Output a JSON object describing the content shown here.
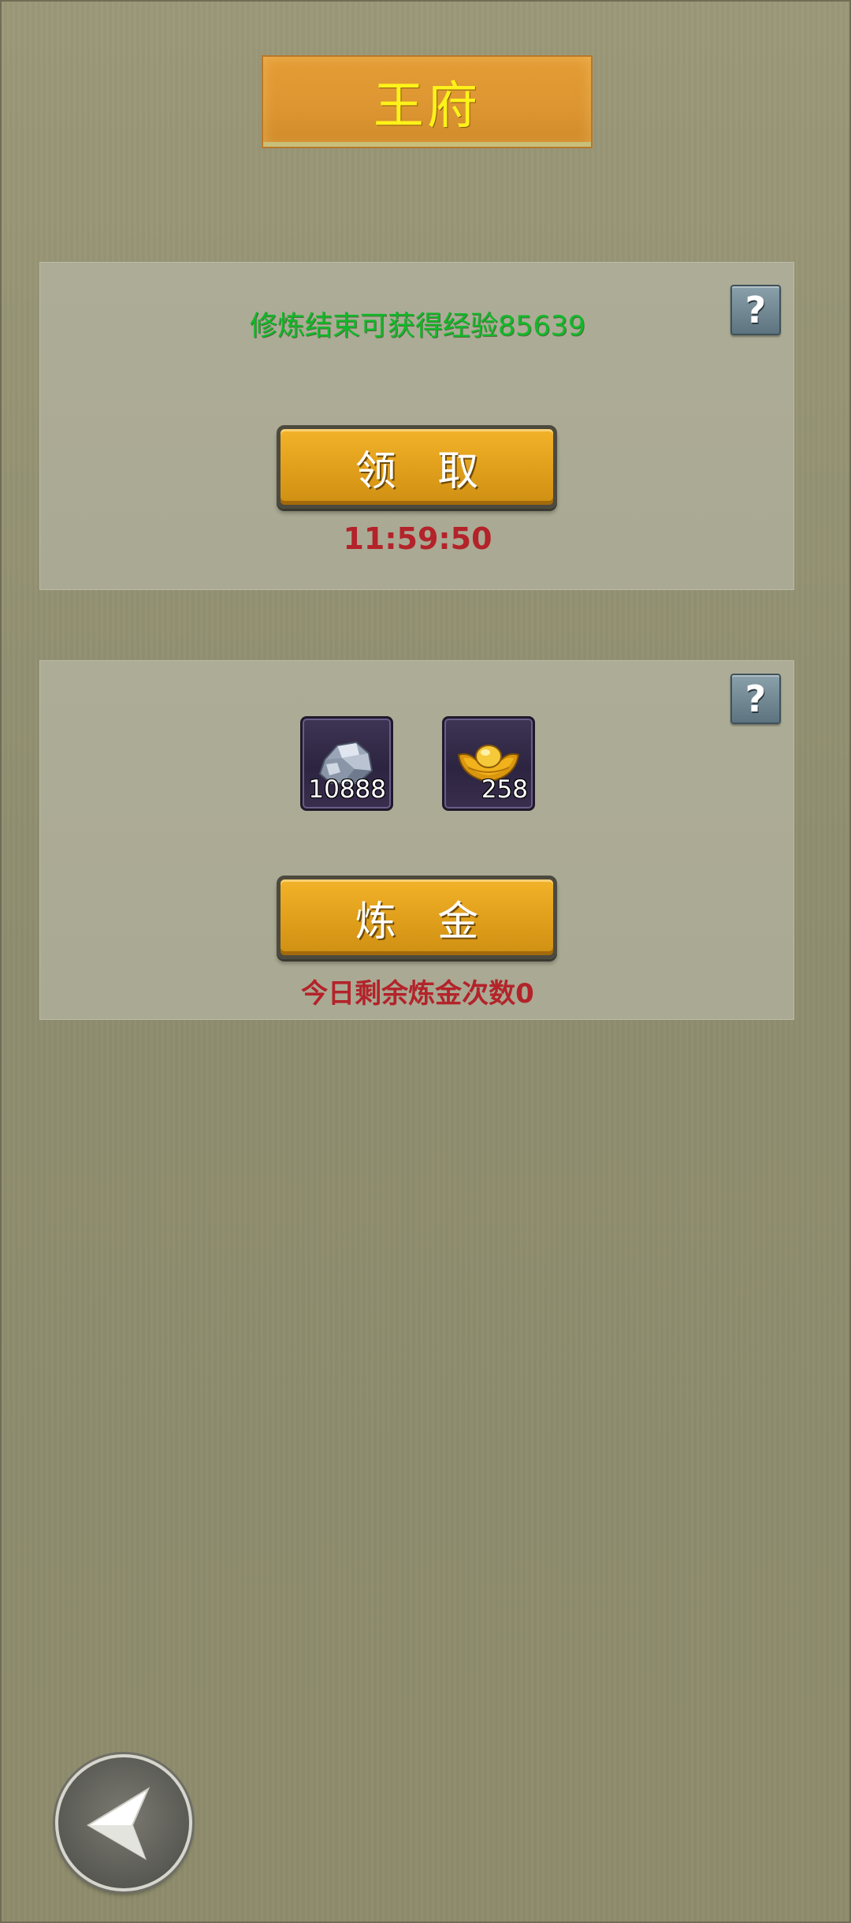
{
  "header": {
    "title": "王府"
  },
  "cultivation_panel": {
    "exp_message": "修炼结束可获得经验85639",
    "claim_button_label": "领 取",
    "countdown": "11:59:50",
    "help_icon": "question-icon"
  },
  "alchemy_panel": {
    "items": [
      {
        "icon": "silver-ore-icon",
        "count": "10888"
      },
      {
        "icon": "gold-ingot-icon",
        "count": "258"
      }
    ],
    "alchemy_button_label": "炼 金",
    "remaining_text": "今日剩余炼金次数0",
    "help_icon": "question-icon"
  },
  "navigation": {
    "back_icon": "back-arrow-icon"
  },
  "colors": {
    "background": "#8f8d6e",
    "panel": "#adac96",
    "title_banner": "#e09a33",
    "title_text": "#fff21a",
    "exp_text": "#12b82a",
    "warning_text": "#b3232a",
    "gold_button": "#e3a21d"
  }
}
